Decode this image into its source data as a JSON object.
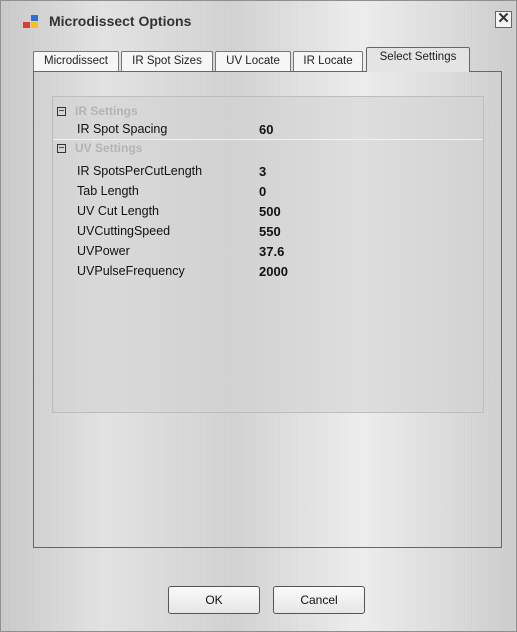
{
  "window": {
    "title": "Microdissect Options"
  },
  "tabs": [
    {
      "label": "Microdissect"
    },
    {
      "label": "IR Spot Sizes"
    },
    {
      "label": "UV Locate"
    },
    {
      "label": "IR Locate"
    },
    {
      "label": "Select Settings",
      "active": true
    }
  ],
  "categories": [
    {
      "name": "IR Settings",
      "properties": [
        {
          "name": "IR Spot Spacing",
          "value": "60"
        }
      ]
    },
    {
      "name": "UV Settings",
      "properties": [
        {
          "name": "IR SpotsPerCutLength",
          "value": "3"
        },
        {
          "name": "Tab Length",
          "value": "0"
        },
        {
          "name": "UV Cut Length",
          "value": "500"
        },
        {
          "name": "UVCuttingSpeed",
          "value": "550"
        },
        {
          "name": "UVPower",
          "value": "37.6"
        },
        {
          "name": "UVPulseFrequency",
          "value": "2000"
        }
      ]
    }
  ],
  "buttons": {
    "ok": "OK",
    "cancel": "Cancel"
  },
  "icons": {
    "app": "app-icon",
    "close": "close-icon",
    "collapse": "collapse-icon"
  },
  "colors": {
    "category_text": "#b3b3b3",
    "value_text": "#111111"
  }
}
